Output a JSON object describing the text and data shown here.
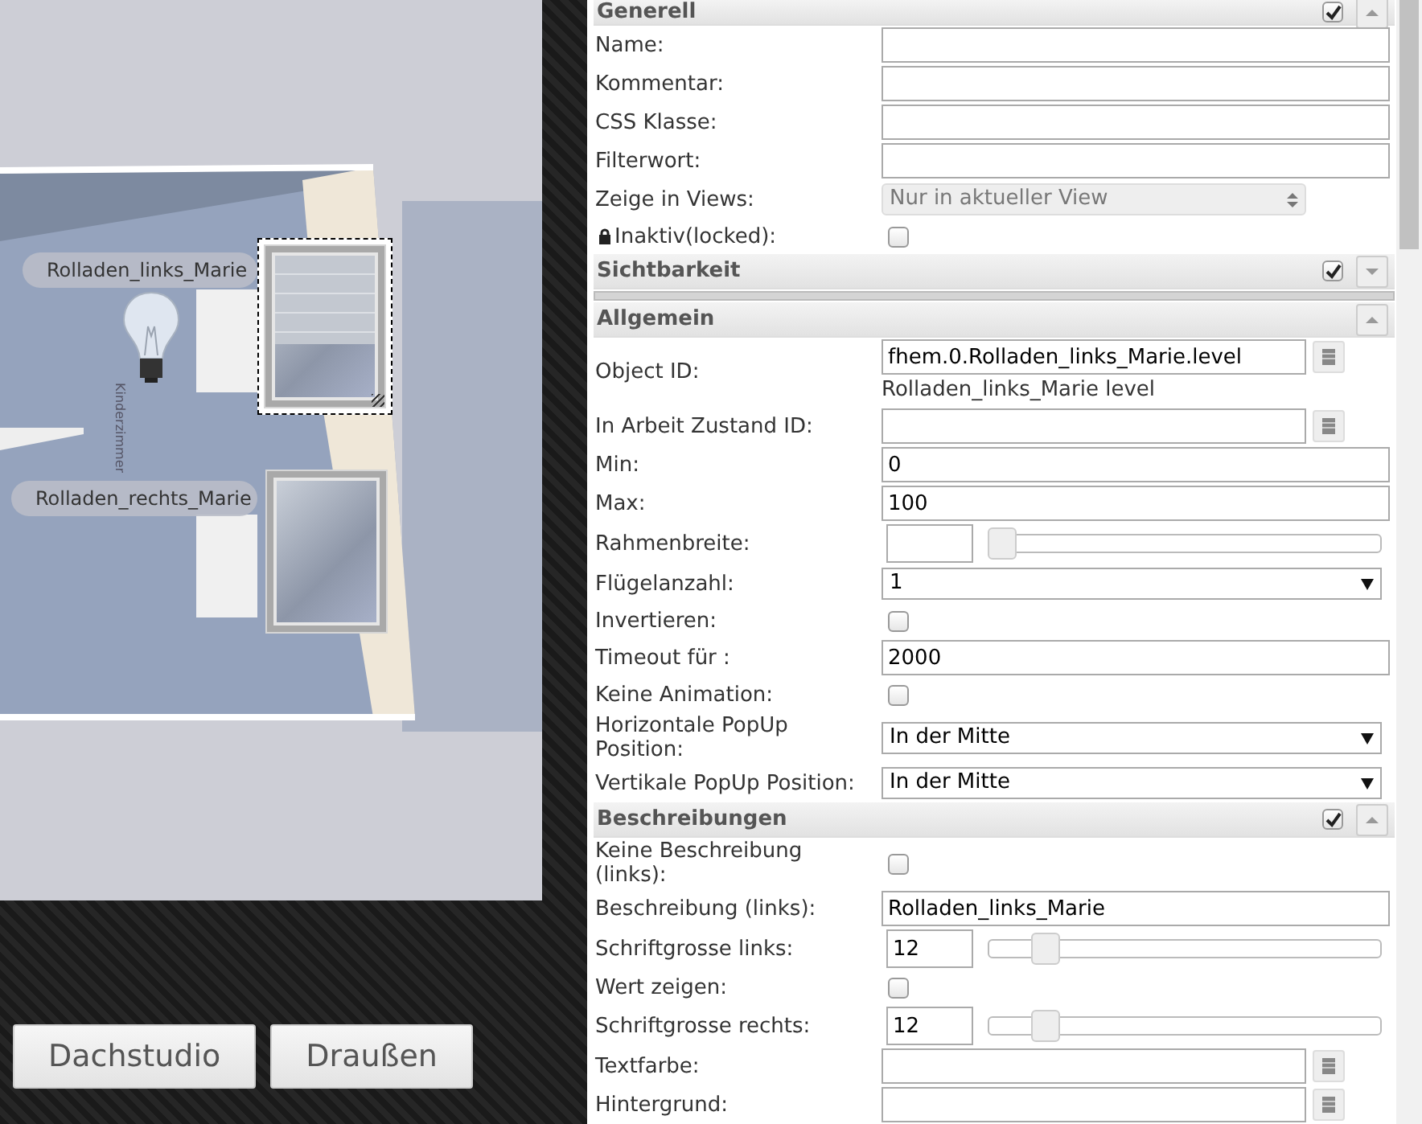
{
  "canvas": {
    "room_label": "Kinderzimmer",
    "widgets": [
      {
        "label": "Rolladen_links_Marie",
        "selected": true
      },
      {
        "label": "Rolladen_rechts_Marie",
        "selected": false
      }
    ]
  },
  "view_buttons": [
    "Dachstudio",
    "Draußen"
  ],
  "sections": [
    {
      "title": "Generell",
      "checked": true,
      "expanded": true,
      "rows": [
        {
          "kind": "text",
          "label": "Name:"
        },
        {
          "kind": "text",
          "label": "Kommentar:"
        },
        {
          "kind": "text",
          "label": "CSS Klasse:"
        },
        {
          "kind": "text",
          "label": "Filterwort:"
        },
        {
          "kind": "select",
          "label": "Zeige in Views:",
          "value": "Nur in aktueller View",
          "disabled": true
        },
        {
          "kind": "lock",
          "label": "Inaktiv(locked):",
          "checked": false
        }
      ]
    },
    {
      "title": "Sichtbarkeit",
      "checked": true,
      "expanded": false
    },
    {
      "title": "Allgemein",
      "expanded": true,
      "rows": [
        {
          "kind": "id",
          "label": "Object ID:",
          "value": "fhem.0.Rolladen_links_Marie.level",
          "note": "Rolladen_links_Marie level"
        },
        {
          "kind": "id",
          "label": "In Arbeit Zustand ID:"
        },
        {
          "kind": "text",
          "label": "Min:",
          "value": "0"
        },
        {
          "kind": "text",
          "label": "Max:",
          "value": "100"
        },
        {
          "kind": "slider",
          "label": "Rahmenbreite:",
          "level": 0
        },
        {
          "kind": "select",
          "label": "Flügelanzahl:",
          "value": "1",
          "disabled": false
        },
        {
          "kind": "checkbox",
          "label": "Invertieren:",
          "checked": false
        },
        {
          "kind": "text",
          "label": "Timeout für :",
          "value": "2000"
        },
        {
          "kind": "checkbox",
          "label": "Keine Animation:",
          "checked": false
        },
        {
          "kind": "select",
          "label": "Horizontale PopUp Position:",
          "value": "In der Mitte",
          "disabled": false
        },
        {
          "kind": "select",
          "label": "Vertikale PopUp Position:",
          "value": "In der Mitte",
          "disabled": false
        }
      ]
    },
    {
      "title": "Beschreibungen",
      "checked": true,
      "expanded": true,
      "rows": [
        {
          "kind": "checkbox",
          "label": "Keine Beschreibung (links):",
          "checked": false
        },
        {
          "kind": "text",
          "label": "Beschreibung (links):",
          "value": "Rolladen_links_Marie"
        },
        {
          "kind": "slider",
          "label": "Schriftgrosse links:",
          "value": "12",
          "level": 0.12
        },
        {
          "kind": "checkbox",
          "label": "Wert zeigen:",
          "checked": false
        },
        {
          "kind": "slider",
          "label": "Schriftgrosse rechts:",
          "value": "12",
          "level": 0.12
        },
        {
          "kind": "id",
          "label": "Textfarbe:"
        },
        {
          "kind": "id",
          "label": "Hintergrund:"
        }
      ]
    }
  ]
}
